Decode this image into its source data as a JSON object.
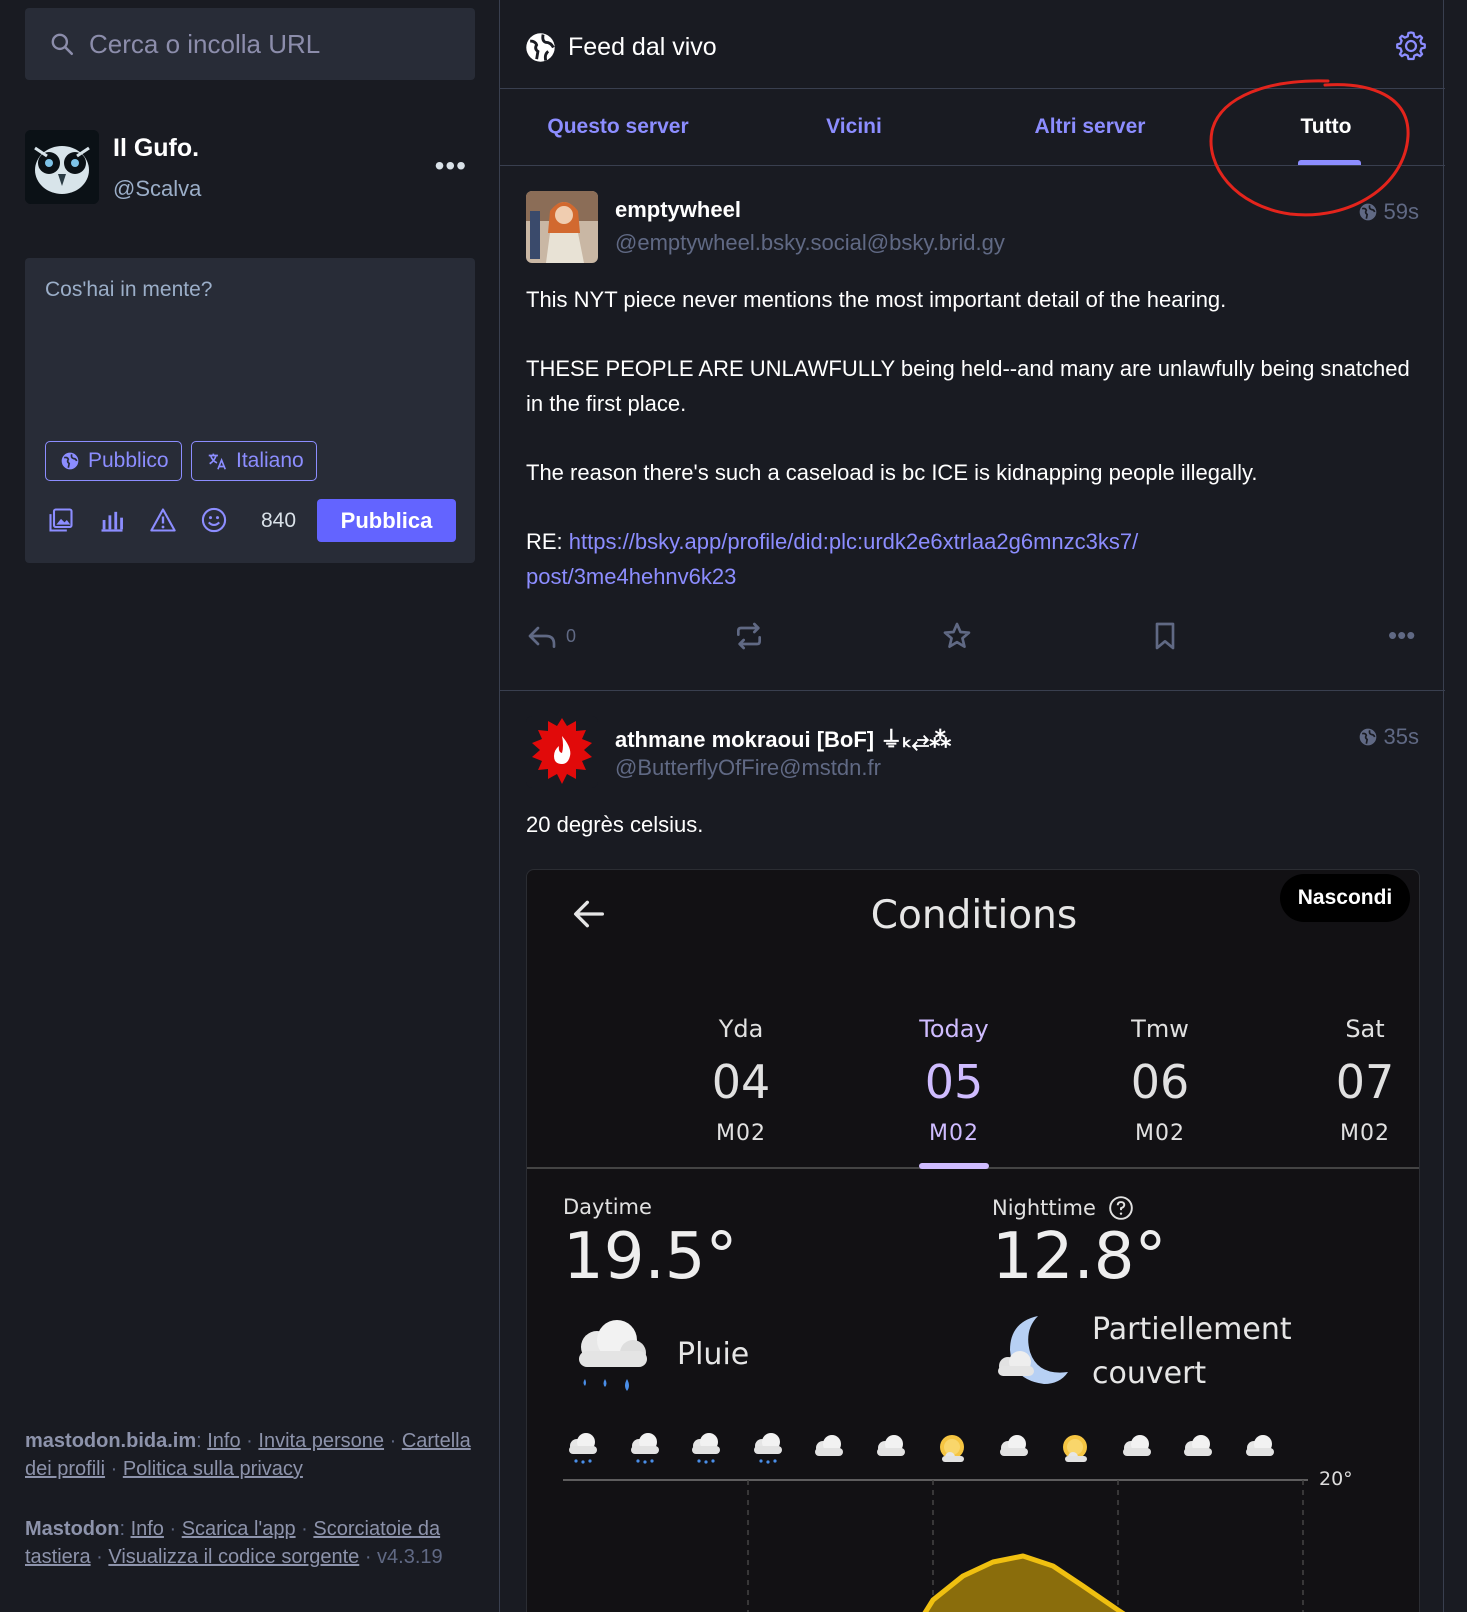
{
  "search": {
    "placeholder": "Cerca o incolla URL"
  },
  "profile": {
    "name": "Il Gufo.",
    "handle": "@Scalva",
    "more": "•••"
  },
  "composer": {
    "placeholder": "Cos'hai in mente?",
    "visibility": "Pubblico",
    "language": "Italiano",
    "counter": "840",
    "publish_label": "Pubblica"
  },
  "footer": {
    "server": "mastodon.bida.im",
    "links1": [
      "Info",
      "Invita persone",
      "Cartella dei profili",
      "Politica sulla privacy"
    ],
    "mastodon": "Mastodon",
    "links2": [
      "Info",
      "Scarica l'app",
      "Scorciatoie da tastiera",
      "Visualizza il codice sorgente"
    ],
    "version": "v4.3.19"
  },
  "column": {
    "title": "Feed dal vivo",
    "tabs": [
      {
        "label": "Questo server",
        "active": false
      },
      {
        "label": "Vicini",
        "active": false
      },
      {
        "label": "Altri server",
        "active": false
      },
      {
        "label": "Tutto",
        "active": true
      }
    ]
  },
  "posts": [
    {
      "name": "emptywheel",
      "acct": "@emptywheel.bsky.social@bsky.brid.gy",
      "time": "59s",
      "paragraphs": [
        "This NYT piece never mentions the most important detail of the hearing.",
        "THESE PEOPLE ARE UNLAWFULLY being held--and many are unlawfully being snatched in the first place.",
        "The reason there's such a caseload is bc ICE is kidnapping people illegally."
      ],
      "re_prefix": "RE: ",
      "link_line1": "https://bsky.app/profile/did:plc:urdk2e6xtrlaa2g6mnzc3ks7/",
      "link_line2": "post/3me4hehnv6k23",
      "reply_count": "0"
    },
    {
      "name": "athmane mokraoui [BoF] ⏚ₖ⥄⁂",
      "acct": "@ButterflyOfFire@mstdn.fr",
      "time": "35s",
      "text": "20 degrès celsius."
    }
  ],
  "media": {
    "hide_label": "Nascondi",
    "title": "Conditions",
    "days": [
      {
        "name": "Yda",
        "date": "04",
        "month": "M02",
        "selected": false
      },
      {
        "name": "Today",
        "date": "05",
        "month": "M02",
        "selected": true
      },
      {
        "name": "Tmw",
        "date": "06",
        "month": "M02",
        "selected": false
      },
      {
        "name": "Sat",
        "date": "07",
        "month": "M02",
        "selected": false
      }
    ],
    "daytime_label": "Daytime",
    "daytime_temp": "19.5°",
    "daytime_condition": "Pluie",
    "nighttime_label": "Nighttime",
    "nighttime_temp": "12.8°",
    "nighttime_condition_line1": "Partiellement",
    "nighttime_condition_line2": "couvert",
    "hourly_icons": [
      "rain-cloud",
      "rain-cloud",
      "rain-cloud",
      "rain-cloud",
      "cloud",
      "cloud",
      "sun-cloud",
      "cloud",
      "sun-cloud",
      "cloud",
      "cloud",
      "cloud"
    ],
    "chart_label": "20°"
  },
  "colors": {
    "accent": "#6364ff",
    "link": "#8c8dff",
    "background": "#191b22",
    "panel": "#282c37",
    "annotation": "#e3241c"
  }
}
